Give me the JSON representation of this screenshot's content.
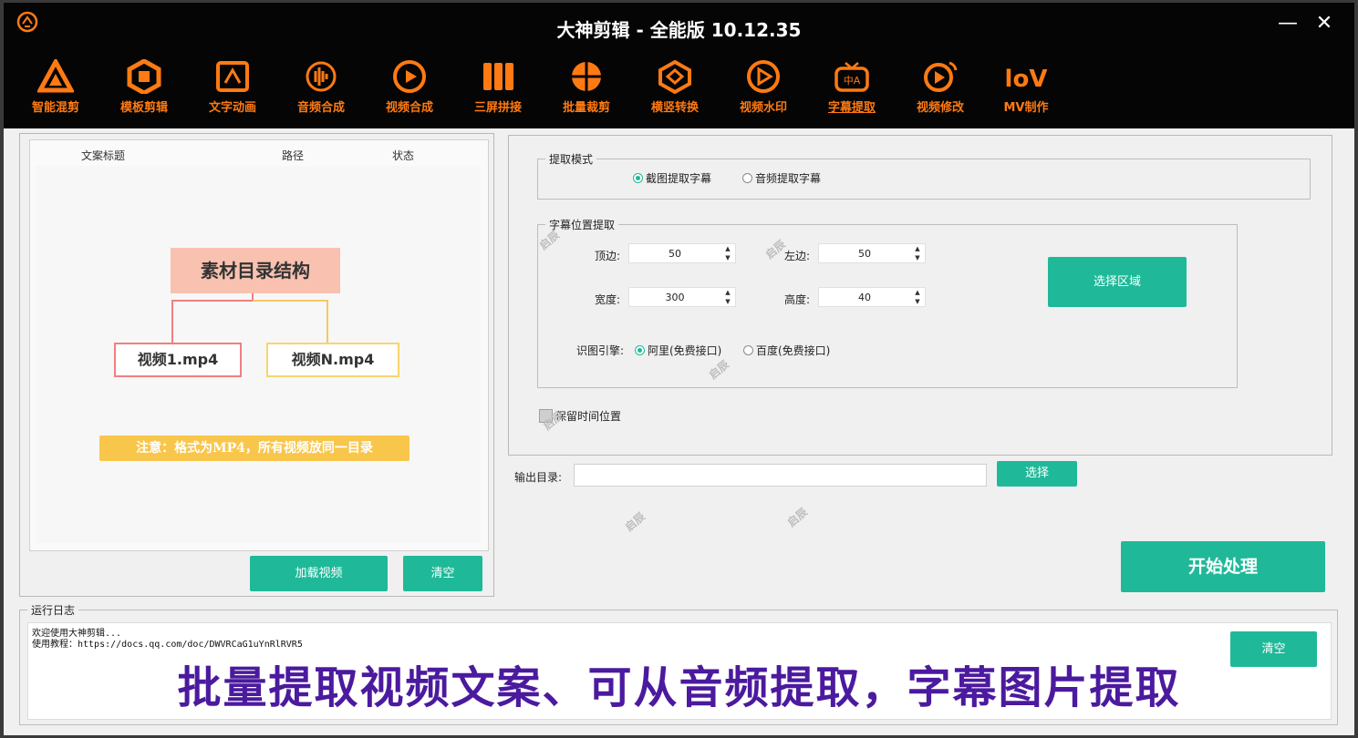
{
  "app": {
    "title": "大神剪辑 - 全能版 10.12.35",
    "minimize": "—",
    "close": "✕"
  },
  "nav": [
    {
      "label": "智能混剪",
      "icon": "triangle-logo-icon"
    },
    {
      "label": "模板剪辑",
      "icon": "hexagon-q-icon"
    },
    {
      "label": "文字动画",
      "icon": "frame-text-icon"
    },
    {
      "label": "音频合成",
      "icon": "audio-wave-icon"
    },
    {
      "label": "视频合成",
      "icon": "video-circle-icon"
    },
    {
      "label": "三屏拼接",
      "icon": "three-screen-icon"
    },
    {
      "label": "批量裁剪",
      "icon": "crop-ball-icon"
    },
    {
      "label": "横竖转换",
      "icon": "rotate-frame-icon"
    },
    {
      "label": "视频水印",
      "icon": "watermark-icon"
    },
    {
      "label": "字幕提取",
      "icon": "subtitle-tv-icon",
      "active": true
    },
    {
      "label": "视频修改",
      "icon": "video-edit-icon"
    },
    {
      "label": "MV制作",
      "icon": "mv-icon"
    }
  ],
  "list": {
    "col_title": "文案标题",
    "col_path": "路径",
    "col_status": "状态",
    "diagram_root": "素材目录结构",
    "diagram_child1": "视频1.mp4",
    "diagram_child2": "视频N.mp4",
    "notice": "注意：格式为MP4，所有视频放同一目录",
    "load_button": "加载视频",
    "clear_button": "清空"
  },
  "extract": {
    "mode_legend": "提取模式",
    "mode_options": [
      "截图提取字幕",
      "音频提取字幕"
    ],
    "mode_selected": "截图提取字幕",
    "pos_legend": "字幕位置提取",
    "top_label": "顶边:",
    "top_value": "50",
    "left_label": "左边:",
    "left_value": "50",
    "width_label": "宽度:",
    "width_value": "300",
    "height_label": "高度:",
    "height_value": "40",
    "select_area_button": "选择区域",
    "engine_label": "识图引擎:",
    "engine_options": [
      "阿里(免费接口)",
      "百度(免费接口)"
    ],
    "engine_selected": "阿里(免费接口)",
    "keep_time_label": "保留时间位置",
    "keep_time_checked": false
  },
  "output": {
    "label": "输出目录:",
    "value": "",
    "choose_button": "选择"
  },
  "start_button": "开始处理",
  "log": {
    "legend": "运行日志",
    "lines": [
      "欢迎使用大神剪辑...",
      "使用教程：https://docs.qq.com/doc/DWVRCaG1uYnRlRVR5"
    ],
    "clear_button": "清空"
  },
  "banner": "批量提取视频文案、可从音频提取，字幕图片提取",
  "watermark": "启辰",
  "colors": {
    "accent": "#1fb999",
    "nav_orange": "#ff7a12",
    "banner": "#4b1a9e"
  }
}
